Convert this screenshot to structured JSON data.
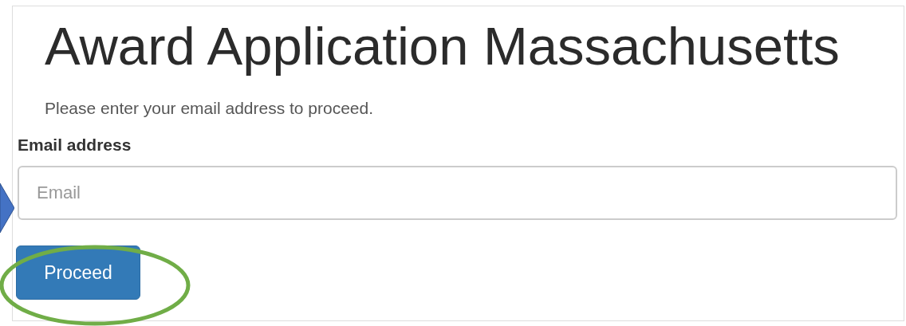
{
  "title": "Award Application Massachusetts",
  "intro": "Please enter your email address to proceed.",
  "email_field": {
    "label": "Email address",
    "placeholder": "Email"
  },
  "submit_button": "Proceed"
}
